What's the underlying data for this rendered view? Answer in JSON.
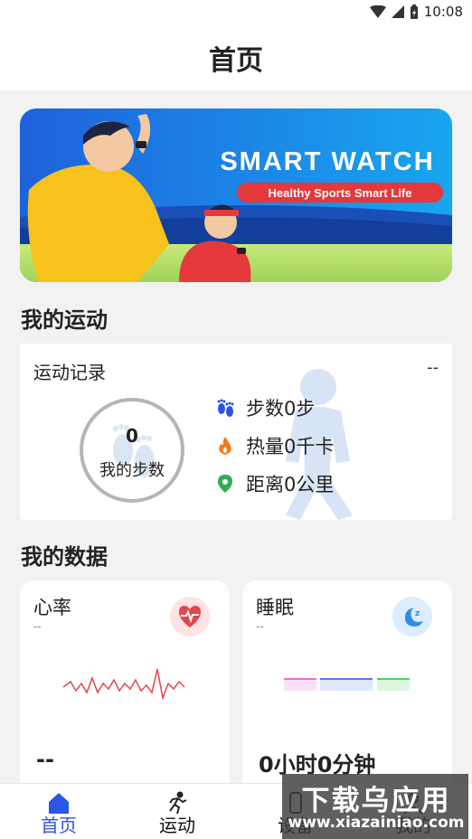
{
  "status_bar": {
    "time": "10:08"
  },
  "header": {
    "title": "首页"
  },
  "banner": {
    "headline": "SMART WATCH",
    "tagline": "Healthy Sports Smart Life"
  },
  "sections": {
    "my_sport": "我的运动",
    "my_data": "我的数据"
  },
  "exercise_record": {
    "title": "运动记录",
    "corner_value": "--",
    "steps_value": "0",
    "steps_label": "我的步数",
    "stats": [
      {
        "icon": "footprints-icon",
        "text": "步数0步"
      },
      {
        "icon": "flame-icon",
        "text": "热量0千卡"
      },
      {
        "icon": "location-pin-icon",
        "text": "距离0公里"
      }
    ]
  },
  "heart_rate": {
    "title": "心率",
    "subtitle": "--",
    "value": "--",
    "icon": "heart-pulse-icon"
  },
  "sleep": {
    "title": "睡眠",
    "subtitle": "--",
    "value": "0小时0分钟",
    "icon": "moon-zz-icon",
    "bar_colors": [
      "#f06ad6",
      "#5b74f0",
      "#46d36b"
    ]
  },
  "bottom_nav": {
    "items": [
      {
        "label": "首页",
        "icon": "home-icon",
        "active": true
      },
      {
        "label": "运动",
        "icon": "runner-icon",
        "active": false
      },
      {
        "label": "设备",
        "icon": "device-icon",
        "active": false
      },
      {
        "label": "我的",
        "icon": "profile-icon",
        "active": false
      }
    ]
  },
  "watermark": {
    "title": "下载乌应用",
    "url": "www.xiazainiao.com"
  },
  "colors": {
    "accent": "#2a55e5",
    "background": "#f2f2f2",
    "heart": "#e0474c",
    "sleep_icon": "#2f8de4"
  }
}
